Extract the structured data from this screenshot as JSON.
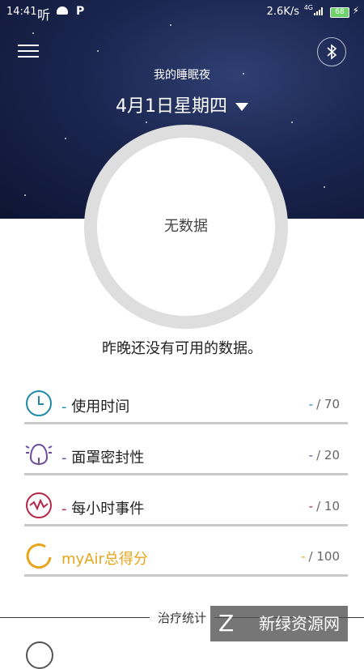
{
  "status_bar": {
    "time": "14:41",
    "app_icon_text": "听",
    "p_icon": "P",
    "speed": "2.6K/s",
    "network": "4G",
    "battery": "68"
  },
  "header": {
    "subtitle": "我的睡眠夜",
    "date": "4月1日星期四"
  },
  "summary": {
    "ring_text": "无数据",
    "message": "昨晚还没有可用的数据。"
  },
  "metrics": [
    {
      "label": "使用时间",
      "prefix": "-",
      "value": "/ 70",
      "dash": "-",
      "color": "#1e8aa8",
      "icon": "clock-icon"
    },
    {
      "label": "面罩密封性",
      "prefix": "-",
      "value": "/ 20",
      "dash": "-",
      "color": "#6b4c9a",
      "icon": "mask-icon"
    },
    {
      "label": "每小时事件",
      "prefix": "-",
      "value": "/ 10",
      "dash": "-",
      "color": "#b3264a",
      "icon": "wave-icon"
    },
    {
      "label": "myAir总得分",
      "prefix": "",
      "value": "/ 100",
      "dash": "-",
      "color": "#e7a61a",
      "icon": "score-icon"
    }
  ],
  "stats": {
    "title": "治疗统计"
  },
  "watermark": {
    "text": "新绿资源网"
  }
}
